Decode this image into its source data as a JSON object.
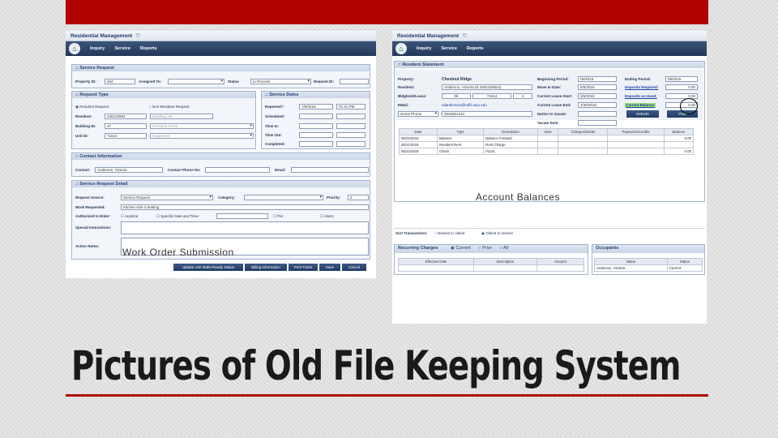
{
  "slide": {
    "title": "Pictures of Old File Keeping System",
    "accent_color": "#b00000"
  },
  "left": {
    "app_title": "Residential Management",
    "nav": [
      "Inquiry",
      "Service",
      "Reports"
    ],
    "sections": {
      "service_request": ":: Service Request",
      "request_type": ":: Request Type",
      "service_dates": ":: Service Dates",
      "contact": ":: Contact Information",
      "detail": ":: Service Request Detail"
    },
    "labels": {
      "property_id": "Property ID:",
      "assigned_to": "Assigned To:",
      "status": "Status",
      "request_id": "Request ID:",
      "resident_request": "Resident Request",
      "non_resident_request": "Non-Resident Request",
      "resident": "Resident:",
      "building_id": "Building ID:",
      "unit_id": "Unit ID:",
      "reported": "Reported:*",
      "scheduled": "Scheduled:",
      "time_in": "Time In:",
      "time_out": "Time Out:",
      "completed": "Completed:",
      "contact": "Contact:",
      "contact_phone": "Contact Phone No:",
      "email": "Email:",
      "request_source": "Request Source:",
      "category": "Category:",
      "priority": "Priority:",
      "work_requested": "Work Requested:",
      "authorized": "Authorized to Enter:",
      "anytime": "Anytime",
      "specific_time": "Specific Date and Time:",
      "pet": "Pet",
      "alarm": "Alarm",
      "special_instructions": "Special Instructions:",
      "action_notes": "Action Notes:"
    },
    "values": {
      "property_id": "454",
      "status": "In Process",
      "resident": "436102854",
      "building_placeholder": "Building List",
      "building_id": "37",
      "common_area": "Common Areas",
      "unit_id": "71514",
      "equipment": "Equipment",
      "reported_date": "7/9/2015",
      "reported_time": "01:31 PM",
      "contact": "Anderson, Victoria",
      "request_source": "Service Request",
      "priority": "4",
      "work_requested": "Kitchen sink is leaking"
    },
    "buttons": [
      "Update Unit Make-Ready Status",
      "Billing Information",
      "Print Ticket",
      "Save",
      "Cancel"
    ],
    "caption": "Work Order Submission"
  },
  "right": {
    "app_title": "Residential Management",
    "nav": [
      "Inquiry",
      "Service",
      "Reports"
    ],
    "section": ":: Resident Statement",
    "labels": {
      "property": "Property:",
      "resident": "Resident:",
      "bldg_unit_lease": "Bldg/Unit/Lease:",
      "email": "EMail:",
      "beginning_period": "Beginning Period:",
      "move_in_date": "Move In Date:",
      "current_lease_start": "Current Lease Start:",
      "current_lease_end": "Current Lease End:",
      "notice_to_vacate": "Notice to Vacate:",
      "vacate_date": "Vacate Date:",
      "ending_period": "Ending Period:",
      "deposits_required": "Deposits Required:",
      "deposits_on_hand": "Deposits on Hand:",
      "current_balance": "Current Balance:"
    },
    "values": {
      "property": "Chestnut Ridge",
      "resident": "Anderson, Victoria (R.4061020634)",
      "bldg": "06",
      "unit": "71514",
      "lease": "4",
      "email": "vdanderson@buffs.wvu.edu",
      "phone_type": "Home Phone",
      "phone": "3045551234",
      "beginning_period": "05/2015",
      "move_in": "5/6/2015",
      "lease_start": "5/6/2015",
      "lease_end": "4/30/2016",
      "ending_period": "05/2015",
      "deposits_required": "0.00",
      "deposits_on_hand": "0.00",
      "current_balance": "0.00"
    },
    "buttons": {
      "refresh": "Refresh",
      "print": "Print"
    },
    "ledger": {
      "headers": [
        "Date",
        "Type",
        "Description",
        "View",
        "Charges/Debits",
        "Payments/Credits",
        "Balance"
      ],
      "rows": [
        [
          "05/21/2015",
          "Balance",
          "Balance Forward",
          "",
          "",
          "",
          "0.00"
        ],
        [
          "05/21/2015",
          "Resident Rent",
          "Rent Charge",
          "",
          "",
          "",
          ""
        ],
        [
          "05/24/2015",
          "Check",
          "#1131",
          "",
          "",
          "",
          "0.00"
        ]
      ]
    },
    "sort_label": "Sort Transactions:",
    "sort_options": [
      "Newest to oldest",
      "Oldest to newest"
    ],
    "recurring": {
      "title": "Recurring Charges",
      "options": [
        "Current",
        "Prior",
        "All"
      ],
      "headers": [
        "Effective Date",
        "Description",
        "Amount"
      ]
    },
    "occupants": {
      "title": "Occupants",
      "headers": [
        "Name",
        "Status"
      ],
      "row": [
        "Anderson, Victoria",
        "Current"
      ]
    },
    "caption": "Account Balances"
  }
}
